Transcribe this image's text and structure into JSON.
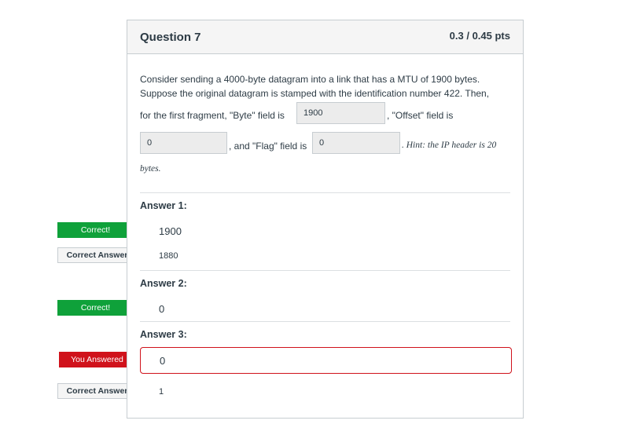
{
  "question": {
    "title": "Question 7",
    "points": "0.3 / 0.45 pts",
    "line1": "Consider sending a 4000-byte datagram into a link that has a MTU of 1900 bytes.",
    "line2": "Suppose the original datagram is stamped with the identification number 422. Then,",
    "line3_a": "for the first fragment, \"Byte\" field is",
    "line3_b": ", \"Offset\" field is",
    "line4_a": ", and \"Flag\" field is",
    "hint": ". Hint: the IP header is 20",
    "hint_cont": "bytes.",
    "input_byte": "1900",
    "input_offset": "0",
    "input_flag": "0"
  },
  "answers": [
    {
      "label": "Answer 1:",
      "given": "1900",
      "status": "Correct!",
      "correct_label": "Correct Answer",
      "correct": "1880"
    },
    {
      "label": "Answer 2:",
      "given": "0",
      "status": "Correct!"
    },
    {
      "label": "Answer 3:",
      "given": "0",
      "status": "You Answered",
      "correct_label": "Correct Answer",
      "correct": "1"
    }
  ],
  "colors": {
    "correct": "#0fa13a",
    "wrong": "#d0121b",
    "border": "#c7cdd1"
  }
}
